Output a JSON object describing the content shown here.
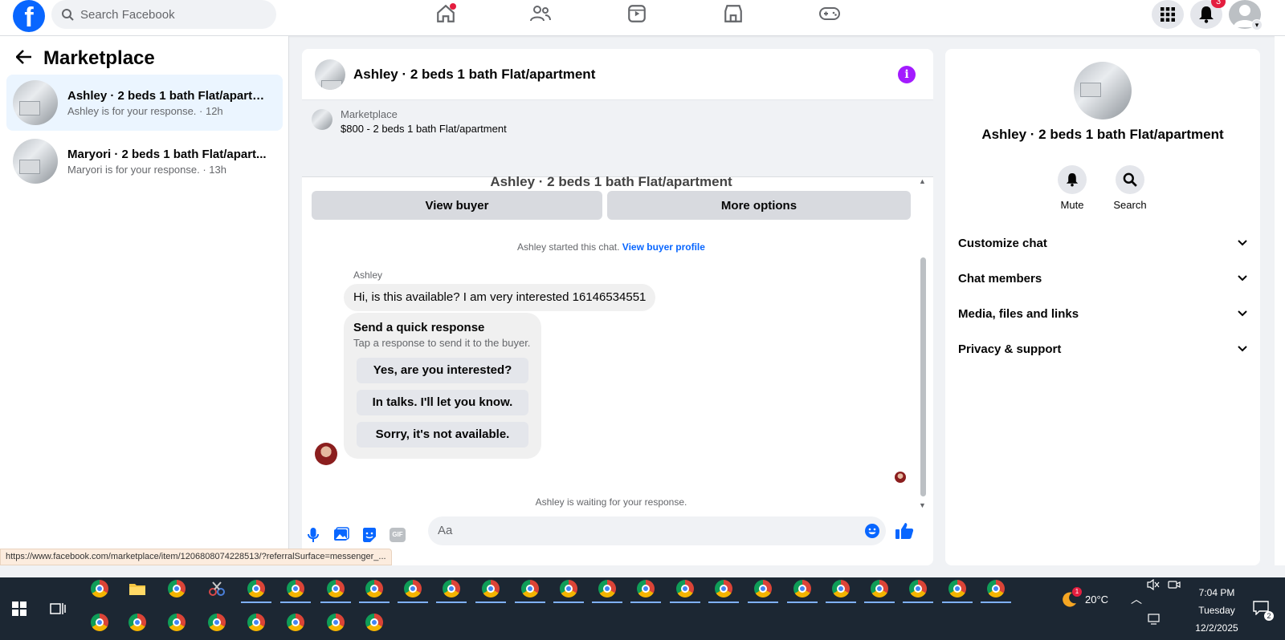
{
  "topbar": {
    "logo": "f",
    "search_placeholder": "Search Facebook",
    "notification_count": "3",
    "colors": {
      "brand": "#0866ff",
      "badge": "#e41e3f"
    }
  },
  "sidebar": {
    "title": "Marketplace",
    "conversations": [
      {
        "title": "Ashley · 2 beds 1 bath Flat/apartm...",
        "subtitle": "Ashley is for your response. · 12h"
      },
      {
        "title": "Maryori · 2 beds 1 bath Flat/apart...",
        "subtitle": "Maryori is for your response. · 13h"
      }
    ]
  },
  "chat": {
    "title": "Ashley · 2 beds 1 bath Flat/apartment",
    "marketplace": {
      "label": "Marketplace",
      "listing": "$800 - 2 beds 1 bath Flat/apartment",
      "view_buyer": "View buyer",
      "more_options": "More options"
    },
    "faded_title": "Ashley · 2 beds 1 bath Flat/apartment",
    "started_text": "Ashley started this chat.",
    "view_buyer_profile": "View buyer profile",
    "sender_name": "Ashley",
    "message": "Hi, is this available? I am very interested 16146534551",
    "quick": {
      "title": "Send a quick response",
      "subtitle": "Tap a response to send it to the buyer.",
      "options": [
        "Yes, are you interested?",
        "In talks. I'll let you know.",
        "Sorry, it's not available."
      ]
    },
    "waiting": "Ashley is waiting for your response.",
    "composer_placeholder": "Aa",
    "gif_label": "GIF"
  },
  "details": {
    "name": "Ashley · 2 beds 1 bath Flat/apartment",
    "actions": [
      "Mute",
      "Search"
    ],
    "sections": [
      "Customize chat",
      "Chat members",
      "Media, files and links",
      "Privacy & support"
    ]
  },
  "status_url": "https://www.facebook.com/marketplace/item/1206808074228513/?referralSurface=messenger_...",
  "taskbar": {
    "weather": "20°C",
    "time": "7:04 PM",
    "day": "Tuesday",
    "date": "12/2/2025",
    "weather_badge": "1",
    "notif_badge": "2"
  }
}
